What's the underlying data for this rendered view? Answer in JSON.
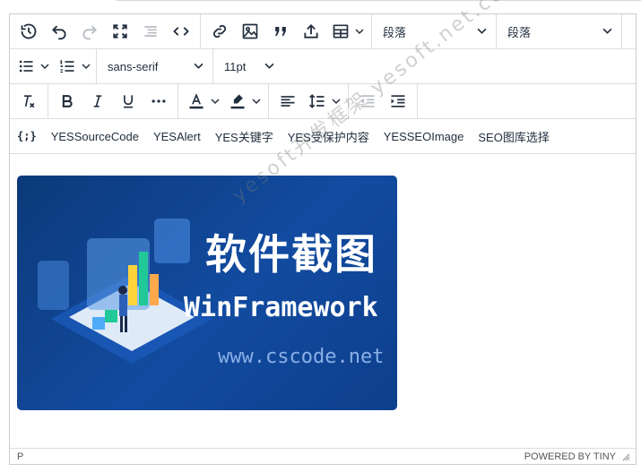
{
  "toolbar": {
    "block_format_1": "段落",
    "block_format_2": "段落",
    "font_family": "sans-serif",
    "font_size": "11pt"
  },
  "custom_buttons": {
    "icon_label": "{;}",
    "source_code": "YESSourceCode",
    "alert": "YESAlert",
    "keywords": "YES关键字",
    "protected": "YES受保护内容",
    "seo_image": "YESSEOImage",
    "gallery": "SEO图库选择"
  },
  "image": {
    "title": "软件截图",
    "subtitle": "WinFramework",
    "url": "www.cscode.net"
  },
  "watermark": "yesoft开发框架 yesoft.net.com",
  "status": {
    "path": "P",
    "powered": "POWERED BY TINY"
  },
  "colors": {
    "banner_dark": "#0c3a7a",
    "banner_mid": "#124ba0",
    "text_color_underline": "#222f3e"
  }
}
